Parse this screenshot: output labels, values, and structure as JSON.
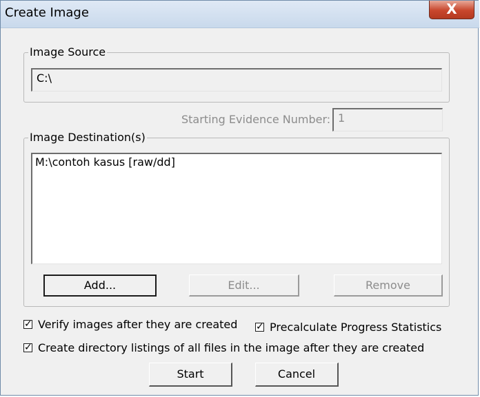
{
  "window": {
    "title": "Create Image",
    "close_glyph": "X"
  },
  "image_source": {
    "legend": "Image Source",
    "value": "C:\\"
  },
  "evidence": {
    "label": "Starting Evidence Number:",
    "value": "1"
  },
  "image_destinations": {
    "legend": "Image Destination(s)",
    "items": [
      "M:\\contoh kasus [raw/dd]"
    ]
  },
  "buttons": {
    "add": "Add...",
    "edit": "Edit...",
    "remove": "Remove",
    "start": "Start",
    "cancel": "Cancel"
  },
  "options": {
    "verify": {
      "label": "Verify images after they are created",
      "checked": true
    },
    "precalculate": {
      "label": "Precalculate Progress Statistics",
      "checked": true
    },
    "directory_listings": {
      "label": "Create directory listings of all files in the image after they are created",
      "checked": true
    }
  },
  "check_glyph": "✓"
}
